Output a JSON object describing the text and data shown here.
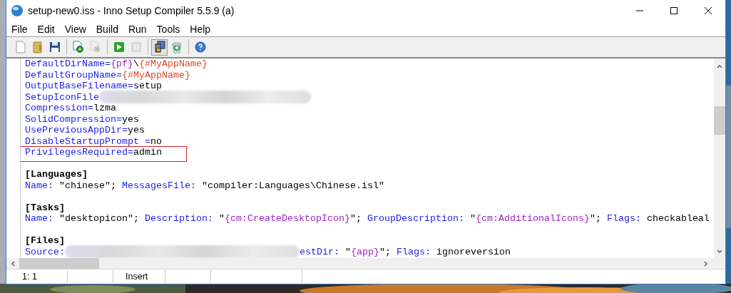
{
  "window": {
    "title": "setup-new0.iss - Inno Setup Compiler 5.5.9 (a)"
  },
  "menu": [
    "File",
    "Edit",
    "View",
    "Build",
    "Run",
    "Tools",
    "Help"
  ],
  "toolbar": [
    [
      {
        "disabled": false,
        "pressed": false
      },
      {
        "disabled": false,
        "pressed": false
      },
      {
        "disabled": false,
        "pressed": false
      }
    ],
    [
      {
        "disabled": false,
        "pressed": false
      },
      {
        "disabled": true,
        "pressed": false
      }
    ],
    [
      {
        "disabled": false,
        "pressed": false
      },
      {
        "disabled": true,
        "pressed": false
      }
    ],
    [
      {
        "disabled": false,
        "pressed": true
      },
      {
        "disabled": false,
        "pressed": false
      }
    ],
    [
      {
        "disabled": false,
        "pressed": false
      }
    ]
  ],
  "editor": {
    "lines": [
      {
        "boxed": false,
        "tokens": [
          {
            "kind": "key",
            "text": "DefaultDirName"
          },
          {
            "kind": "sym",
            "text": "="
          },
          {
            "kind": "const",
            "text": "{pf}"
          },
          {
            "kind": "val",
            "text": "\\"
          },
          {
            "kind": "pre",
            "text": "{#MyAppName}"
          }
        ]
      },
      {
        "boxed": false,
        "tokens": [
          {
            "kind": "key",
            "text": "DefaultGroupName"
          },
          {
            "kind": "sym",
            "text": "="
          },
          {
            "kind": "pre",
            "text": "{#MyAppName}"
          }
        ]
      },
      {
        "boxed": false,
        "tokens": [
          {
            "kind": "key",
            "text": "OutputBaseFilename"
          },
          {
            "kind": "sym",
            "text": "="
          },
          {
            "kind": "val",
            "text": "setup"
          }
        ]
      },
      {
        "boxed": false,
        "tokens": [
          {
            "kind": "key",
            "text": "SetupIconFile"
          },
          {
            "kind": "blur"
          }
        ]
      },
      {
        "boxed": false,
        "tokens": [
          {
            "kind": "key",
            "text": "Compression"
          },
          {
            "kind": "sym",
            "text": "="
          },
          {
            "kind": "val",
            "text": "lzma"
          }
        ]
      },
      {
        "boxed": false,
        "tokens": [
          {
            "kind": "key",
            "text": "SolidCompression"
          },
          {
            "kind": "sym",
            "text": "="
          },
          {
            "kind": "val",
            "text": "yes"
          }
        ]
      },
      {
        "boxed": false,
        "tokens": [
          {
            "kind": "key",
            "text": "UsePreviousAppDir"
          },
          {
            "kind": "sym",
            "text": "="
          },
          {
            "kind": "val",
            "text": "yes"
          }
        ]
      },
      {
        "boxed": false,
        "tokens": [
          {
            "kind": "key",
            "text": "DisableStartupPrompt"
          },
          {
            "kind": "sym",
            "text": " ="
          },
          {
            "kind": "val",
            "text": "no"
          }
        ]
      },
      {
        "boxed": true,
        "tokens": [
          {
            "kind": "key",
            "text": "PrivilegesRequired"
          },
          {
            "kind": "sym",
            "text": "="
          },
          {
            "kind": "val",
            "text": "admin"
          }
        ]
      },
      {
        "boxed": false
      },
      {
        "boxed": false,
        "tokens": [
          {
            "kind": "section",
            "text": "[Languages]"
          }
        ]
      },
      {
        "boxed": false,
        "tokens": [
          {
            "kind": "key",
            "text": "Name"
          },
          {
            "kind": "sym",
            "text": ": "
          },
          {
            "kind": "val",
            "text": "\"chinese\"; "
          },
          {
            "kind": "key",
            "text": "MessagesFile"
          },
          {
            "kind": "sym",
            "text": ": "
          },
          {
            "kind": "val",
            "text": "\"compiler:Languages\\Chinese.isl\""
          }
        ]
      },
      {
        "boxed": false
      },
      {
        "boxed": false,
        "tokens": [
          {
            "kind": "section",
            "text": "[Tasks]"
          }
        ]
      },
      {
        "boxed": false,
        "tokens": [
          {
            "kind": "key",
            "text": "Name"
          },
          {
            "kind": "sym",
            "text": ": "
          },
          {
            "kind": "val",
            "text": "\"desktopicon\"; "
          },
          {
            "kind": "key",
            "text": "Description"
          },
          {
            "kind": "sym",
            "text": ": "
          },
          {
            "kind": "val",
            "text": "\""
          },
          {
            "kind": "const",
            "text": "{cm:CreateDesktopIcon}"
          },
          {
            "kind": "val",
            "text": "\"; "
          },
          {
            "kind": "key",
            "text": "GroupDescription"
          },
          {
            "kind": "sym",
            "text": ": "
          },
          {
            "kind": "val",
            "text": "\""
          },
          {
            "kind": "const",
            "text": "{cm:AdditionalIcons}"
          },
          {
            "kind": "val",
            "text": "\"; "
          },
          {
            "kind": "key",
            "text": "Flags"
          },
          {
            "kind": "sym",
            "text": ": "
          },
          {
            "kind": "val",
            "text": "checkableal"
          }
        ]
      },
      {
        "boxed": false
      },
      {
        "boxed": false,
        "tokens": [
          {
            "kind": "section",
            "text": "[Files]"
          }
        ]
      },
      {
        "boxed": false,
        "tokens": [
          {
            "kind": "key",
            "text": "Source"
          },
          {
            "kind": "sym",
            "text": ":"
          },
          {
            "kind": "blur"
          },
          {
            "kind": "key",
            "text": "estDir"
          },
          {
            "kind": "sym",
            "text": ": "
          },
          {
            "kind": "val",
            "text": "\""
          },
          {
            "kind": "const",
            "text": "{app}"
          },
          {
            "kind": "val",
            "text": "\"; "
          },
          {
            "kind": "key",
            "text": "Flags"
          },
          {
            "kind": "sym",
            "text": ": "
          },
          {
            "kind": "val",
            "text": "ignoreversion"
          }
        ]
      }
    ]
  },
  "status_bar": {
    "position": "1:  1",
    "mode": "Insert"
  }
}
